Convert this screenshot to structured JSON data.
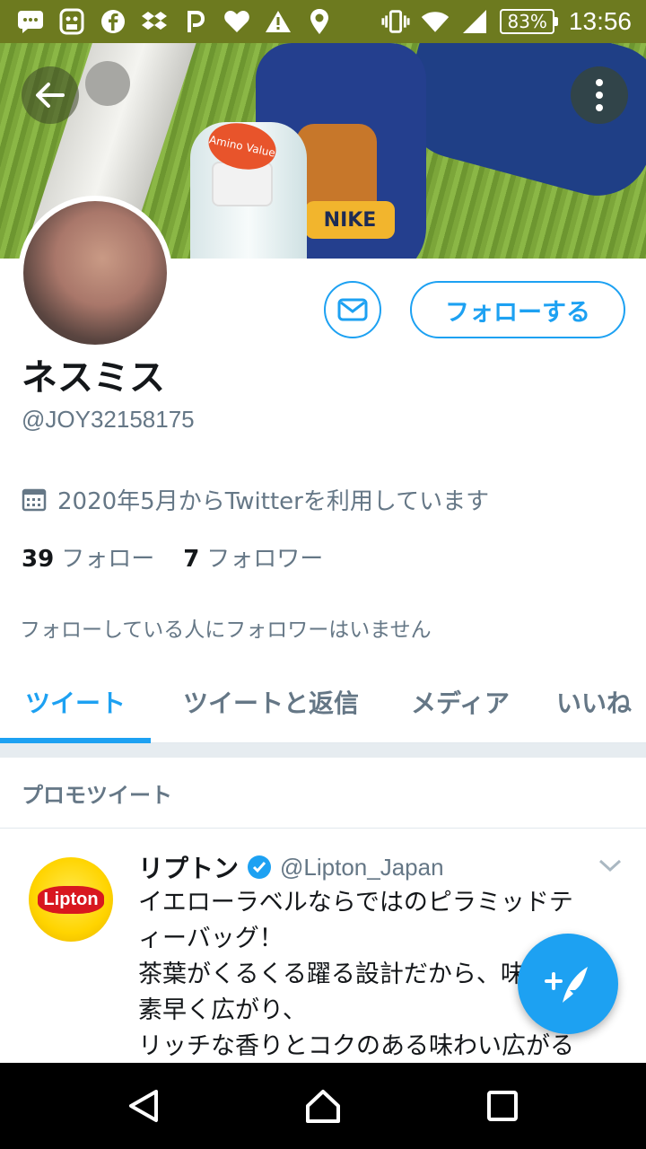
{
  "status_bar": {
    "battery": "83%",
    "time": "13:56",
    "left_icons": [
      "message-icon",
      "android-icon",
      "facebook-icon",
      "dropbox-icon",
      "p-icon",
      "heart-icon",
      "warning-icon",
      "location-icon"
    ],
    "right_icons": [
      "vibrate-icon",
      "wifi-icon",
      "signal-icon"
    ]
  },
  "banner": {
    "nike_text": "NIKE",
    "bottle_cap_text": "Amino Value"
  },
  "profile": {
    "name": "ネスミス",
    "handle": "@JOY32158175",
    "joined": "2020年5月からTwitterを利用しています",
    "following_count": "39",
    "following_label": "フォロー",
    "followers_count": "7",
    "followers_label": "フォロワー",
    "no_mutual_text": "フォローしている人にフォロワーはいません",
    "follow_button": "フォローする"
  },
  "tabs": [
    {
      "label": "ツイート",
      "active": true
    },
    {
      "label": "ツイートと返信",
      "active": false
    },
    {
      "label": "メディア",
      "active": false
    },
    {
      "label": "いいね",
      "active": false
    }
  ],
  "promo_header": "プロモツイート",
  "tweet": {
    "name": "リプトン",
    "handle": "@Lipton_Japan",
    "logo_text": "Lipton",
    "lines": [
      "イエローラベルならではのピラミッドテ",
      "ィーバッグ！",
      "茶葉がくるくる躍る設計だから、味が",
      "素早く広がり、",
      "リッチな香りとコクのある味わい広がる"
    ]
  },
  "colors": {
    "accent": "#1da1f2",
    "status_bar": "#6d7a1f",
    "secondary_text": "#657786"
  }
}
